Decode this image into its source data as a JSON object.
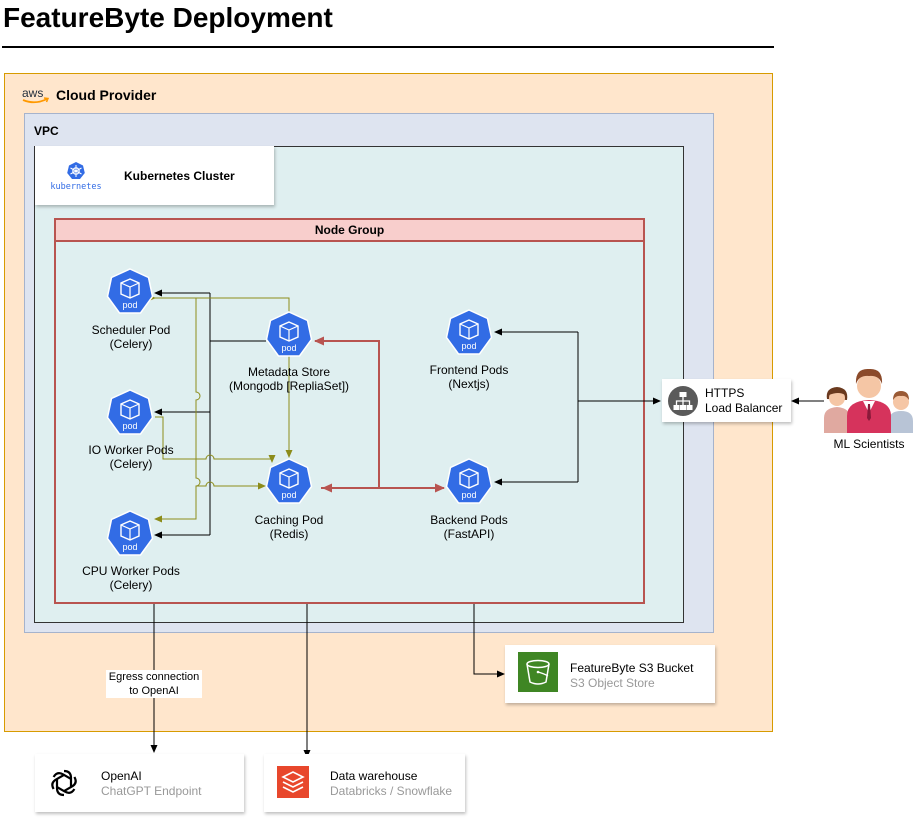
{
  "title": "FeatureByte Deployment",
  "cloud": {
    "label": "Cloud Provider",
    "logo": "aws"
  },
  "vpc": {
    "label": "VPC"
  },
  "cluster": {
    "label": "Kubernetes Cluster",
    "logo": "kubernetes"
  },
  "node_group": {
    "label": "Node Group"
  },
  "pods": {
    "badge": "pod",
    "scheduler": {
      "line1": "Scheduler Pod",
      "line2": "(Celery)"
    },
    "io_worker": {
      "line1": "IO Worker Pods",
      "line2": "(Celery)"
    },
    "cpu_worker": {
      "line1": "CPU Worker Pods",
      "line2": "(Celery)"
    },
    "metadata": {
      "line1": "Metadata Store",
      "line2": "(Mongodb [RepliaSet])"
    },
    "caching": {
      "line1": "Caching Pod",
      "line2": "(Redis)"
    },
    "frontend": {
      "line1": "Frontend Pods",
      "line2": "(Nextjs)"
    },
    "backend": {
      "line1": "Backend Pods",
      "line2": "(FastAPI)"
    }
  },
  "load_balancer": {
    "line1": "HTTPS",
    "line2": "Load Balancer"
  },
  "users": {
    "label": "ML Scientists"
  },
  "s3": {
    "title": "FeatureByte S3 Bucket",
    "subtitle": "S3 Object Store"
  },
  "egress": {
    "line1": "Egress connection",
    "line2": "to OpenAI"
  },
  "openai": {
    "title": "OpenAI",
    "subtitle": "ChatGPT Endpoint"
  },
  "warehouse": {
    "title": "Data warehouse",
    "subtitle": "Databricks / Snowflake"
  },
  "colors": {
    "pod_blue": "#326ce5",
    "olive_arrow": "#8c8c1a",
    "red_arrow": "#b85450",
    "s3_green": "#3f8624",
    "warehouse_red": "#e8472c"
  }
}
